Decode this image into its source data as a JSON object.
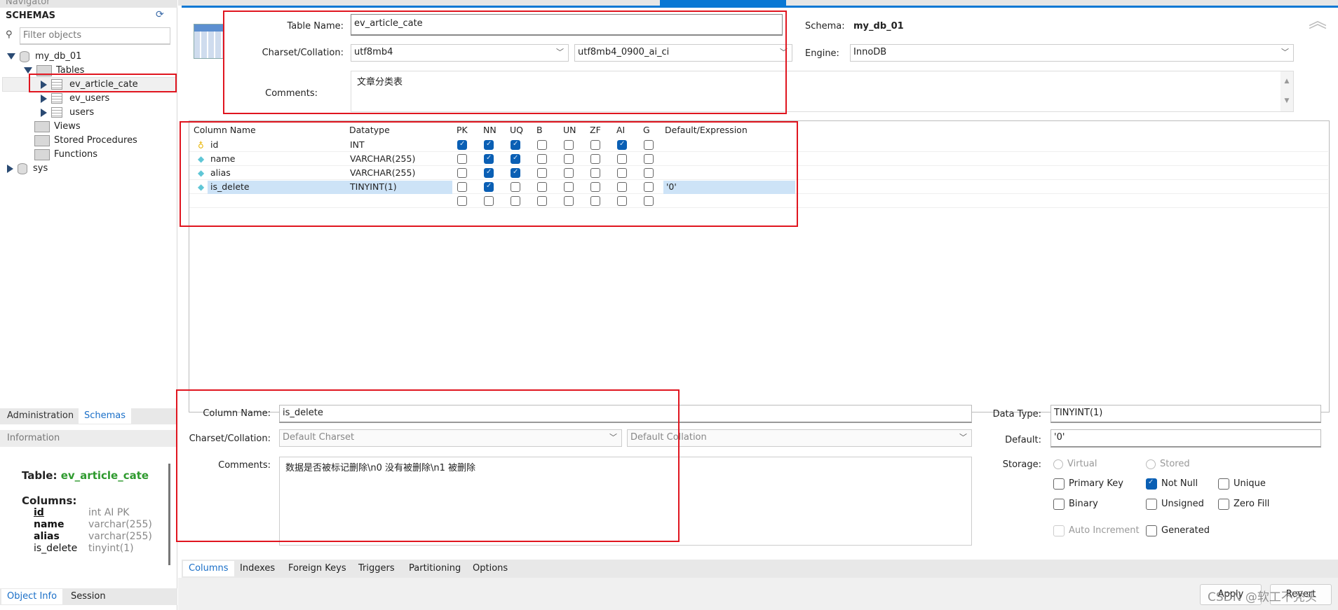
{
  "sidebar": {
    "header": "Navigator",
    "title": "SCHEMAS",
    "filter_placeholder": "Filter objects",
    "tree": {
      "db1": "my_db_01",
      "tables": "Tables",
      "table_items": [
        "ev_article_cate",
        "ev_users",
        "users"
      ],
      "views": "Views",
      "procedures": "Stored Procedures",
      "functions": "Functions",
      "db2": "sys"
    },
    "tabs": [
      "Administration",
      "Schemas"
    ],
    "info_header": "Information",
    "info": {
      "table_label": "Table:",
      "table_name": "ev_article_cate",
      "columns_label": "Columns:",
      "columns": [
        {
          "name": "id",
          "type": "int AI PK"
        },
        {
          "name": "name",
          "type": "varchar(255)"
        },
        {
          "name": "alias",
          "type": "varchar(255)"
        },
        {
          "name": "is_delete",
          "type": "tinyint(1)"
        }
      ]
    },
    "bottom_tabs": [
      "Object Info",
      "Session"
    ]
  },
  "editor": {
    "table_name_label": "Table Name:",
    "table_name": "ev_article_cate",
    "schema_label": "Schema:",
    "schema": "my_db_01",
    "charset_label": "Charset/Collation:",
    "charset": "utf8mb4",
    "collation": "utf8mb4_0900_ai_ci",
    "engine_label": "Engine:",
    "engine": "InnoDB",
    "comments_label": "Comments:",
    "comments": "文章分类表"
  },
  "grid": {
    "headers": [
      "Column Name",
      "Datatype",
      "PK",
      "NN",
      "UQ",
      "B",
      "UN",
      "ZF",
      "AI",
      "G",
      "Default/Expression"
    ],
    "rows": [
      {
        "name": "id",
        "type": "INT",
        "flags": [
          true,
          true,
          true,
          false,
          false,
          false,
          true,
          false
        ],
        "default": "",
        "icon": "key-icon"
      },
      {
        "name": "name",
        "type": "VARCHAR(255)",
        "flags": [
          false,
          true,
          true,
          false,
          false,
          false,
          false,
          false
        ],
        "default": "",
        "icon": "diamond-icon"
      },
      {
        "name": "alias",
        "type": "VARCHAR(255)",
        "flags": [
          false,
          true,
          true,
          false,
          false,
          false,
          false,
          false
        ],
        "default": "",
        "icon": "diamond-icon"
      },
      {
        "name": "is_delete",
        "type": "TINYINT(1)",
        "flags": [
          false,
          true,
          false,
          false,
          false,
          false,
          false,
          false
        ],
        "default": "'0'",
        "icon": "diamond-icon",
        "selected": true
      },
      {
        "name": "",
        "type": "",
        "flags": [
          false,
          false,
          false,
          false,
          false,
          false,
          false,
          false
        ],
        "default": ""
      }
    ]
  },
  "detail": {
    "column_name_label": "Column Name:",
    "column_name": "is_delete",
    "charset_label": "Charset/Collation:",
    "charset": "Default Charset",
    "collation": "Default Collation",
    "comments_label": "Comments:",
    "comments": "数据是否被标记删除\\n0 没有被删除\\n1 被删除",
    "data_type_label": "Data Type:",
    "data_type": "TINYINT(1)",
    "default_label": "Default:",
    "default": "'0'",
    "storage_label": "Storage:",
    "storage_options": [
      "Virtual",
      "Stored"
    ],
    "flags": [
      {
        "label": "Primary Key",
        "checked": false
      },
      {
        "label": "Not Null",
        "checked": true
      },
      {
        "label": "Unique",
        "checked": false
      },
      {
        "label": "Binary",
        "checked": false
      },
      {
        "label": "Unsigned",
        "checked": false
      },
      {
        "label": "Zero Fill",
        "checked": false
      },
      {
        "label": "Auto Increment",
        "checked": false,
        "disabled": true
      },
      {
        "label": "Generated",
        "checked": false
      }
    ]
  },
  "bottom_tabs": [
    "Columns",
    "Indexes",
    "Foreign Keys",
    "Triggers",
    "Partitioning",
    "Options"
  ],
  "buttons": {
    "apply": "Apply",
    "revert": "Revert"
  },
  "watermark": "CSDN @软工不秃头",
  "colors": {
    "accent": "#0a78d4",
    "annotation": "#e0151f",
    "info_table": "#2e9a2e"
  }
}
